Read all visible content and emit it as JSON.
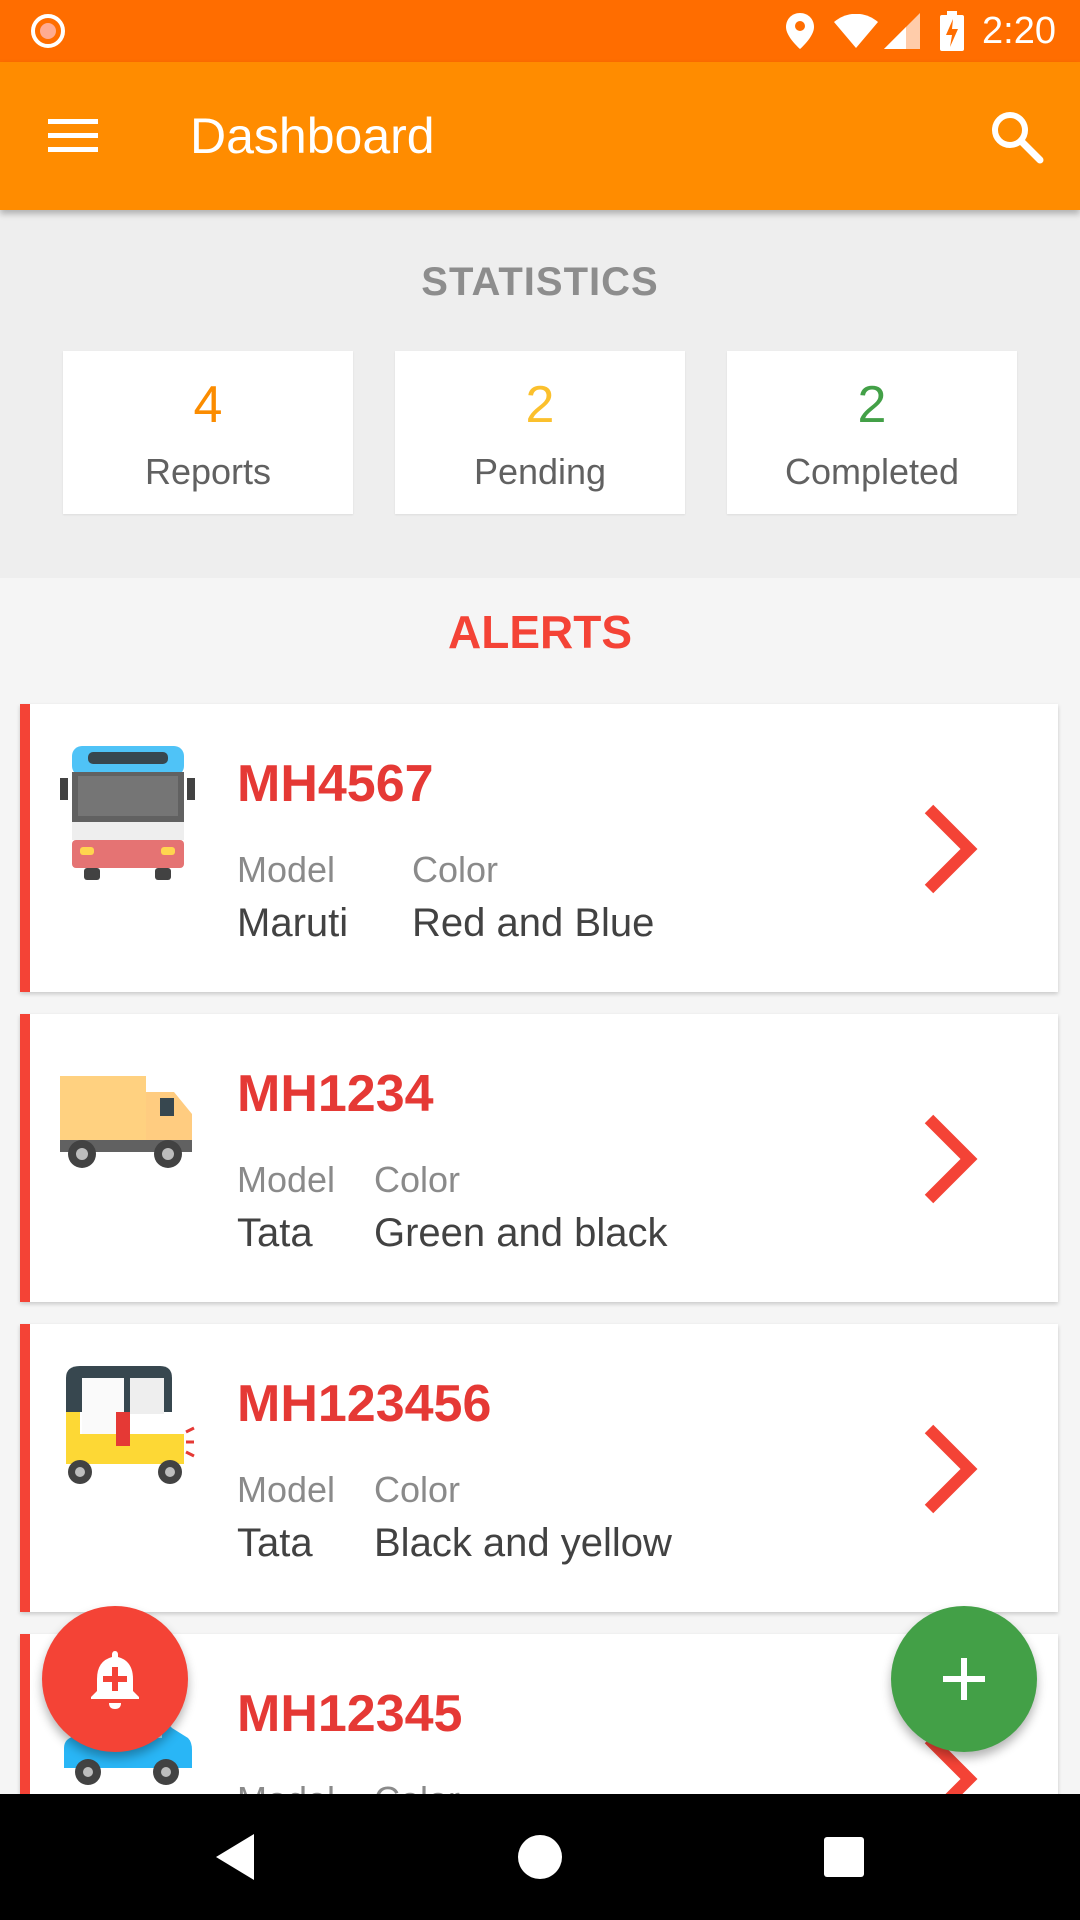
{
  "status_bar": {
    "time": "2:20",
    "icons": [
      "record-icon",
      "location-icon",
      "wifi-icon",
      "signal-icon",
      "battery-charging-icon"
    ]
  },
  "app_bar": {
    "title": "Dashboard",
    "menu_icon": "menu-icon",
    "search_icon": "search-icon",
    "color": "#ff8c00"
  },
  "statistics": {
    "title": "STATISTICS",
    "cards": [
      {
        "value": "4",
        "label": "Reports",
        "color": "#fb8c00"
      },
      {
        "value": "2",
        "label": "Pending",
        "color": "#fbc02d"
      },
      {
        "value": "2",
        "label": "Completed",
        "color": "#43a047"
      }
    ]
  },
  "alerts": {
    "title": "ALERTS",
    "items": [
      {
        "plate": "MH4567",
        "model_label": "Model",
        "model": "Maruti",
        "color_label": "Color",
        "color": "Red and Blue",
        "vehicle_icon": "bus-icon"
      },
      {
        "plate": "MH1234",
        "model_label": "Model",
        "model": "Tata",
        "color_label": "Color",
        "color": "Green and black",
        "vehicle_icon": "truck-icon"
      },
      {
        "plate": "MH123456",
        "model_label": "Model",
        "model": "Tata",
        "color_label": "Color",
        "color": "Black and yellow",
        "vehicle_icon": "auto-rickshaw-icon"
      },
      {
        "plate": "MH12345",
        "model_label": "Model",
        "model": "",
        "color_label": "Color",
        "color": "",
        "vehicle_icon": "car-icon"
      }
    ]
  },
  "fabs": {
    "alert_icon": "alarm-add-icon",
    "add_icon": "plus-icon"
  },
  "nav_bar": {
    "icons": [
      "back-icon",
      "home-icon",
      "recents-icon"
    ]
  }
}
